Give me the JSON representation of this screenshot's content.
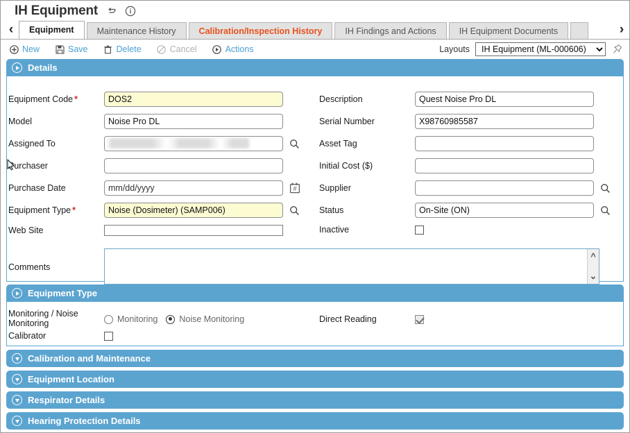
{
  "window": {
    "title": "IH Equipment",
    "title_icons": [
      "undo-icon",
      "info-icon"
    ]
  },
  "tabs": {
    "prev_label": "‹",
    "next_label": "›",
    "items": [
      {
        "label": "Equipment",
        "state": "active"
      },
      {
        "label": "Maintenance History",
        "state": "normal"
      },
      {
        "label": "Calibration/Inspection History",
        "state": "alert"
      },
      {
        "label": "IH Findings and Actions",
        "state": "normal"
      },
      {
        "label": "IH Equipment Documents",
        "state": "normal"
      }
    ]
  },
  "toolbar": {
    "new_label": "New",
    "save_label": "Save",
    "delete_label": "Delete",
    "cancel_label": "Cancel",
    "actions_label": "Actions",
    "layouts_label": "Layouts",
    "layout_selected": "IH Equipment (ML-000606)",
    "layout_options": [
      "IH Equipment (ML-000606)"
    ]
  },
  "details": {
    "section_title": "Details",
    "equipment_code_label": "Equipment Code",
    "equipment_code_value": "DOS2",
    "model_label": "Model",
    "model_value": "Noise Pro DL",
    "assigned_to_label": "Assigned To",
    "assigned_to_value": "",
    "purchaser_label": "Purchaser",
    "purchaser_value": "",
    "purchase_date_label": "Purchase Date",
    "purchase_date_placeholder": "mm/dd/yyyy",
    "purchase_date_value": "",
    "equipment_type_label": "Equipment Type",
    "equipment_type_value": "Noise (Dosimeter) (SAMP006)",
    "web_site_label": "Web Site",
    "web_site_value": "",
    "description_label": "Description",
    "description_value": "Quest Noise Pro DL",
    "serial_number_label": "Serial Number",
    "serial_number_value": "X98760985587",
    "asset_tag_label": "Asset Tag",
    "asset_tag_value": "",
    "initial_cost_label": "Initial Cost ($)",
    "initial_cost_value": "",
    "supplier_label": "Supplier",
    "supplier_value": "",
    "status_label": "Status",
    "status_value": "On-Site (ON)",
    "inactive_label": "Inactive",
    "inactive_checked": false,
    "comments_label": "Comments",
    "comments_value": ""
  },
  "equipment_type": {
    "section_title": "Equipment Type",
    "monitoring_label_line1": "Monitoring / Noise",
    "monitoring_label_line2": "Monitoring",
    "radio_monitoring_label": "Monitoring",
    "radio_noise_monitoring_label": "Noise Monitoring",
    "radio_selected": "Noise Monitoring",
    "calibrator_label": "Calibrator",
    "calibrator_checked": false,
    "direct_reading_label": "Direct Reading",
    "direct_reading_checked": true
  },
  "collapsed_sections": [
    {
      "title": "Calibration and Maintenance"
    },
    {
      "title": "Equipment Location"
    },
    {
      "title": "Respirator Details"
    },
    {
      "title": "Hearing Protection Details"
    }
  ],
  "colors": {
    "section_blue": "#5ba4d0",
    "accent_link": "#4a9fd4",
    "alert_tab": "#e8521f",
    "required_field_bg": "#fdfbd2",
    "required_star": "#d02b1f"
  }
}
